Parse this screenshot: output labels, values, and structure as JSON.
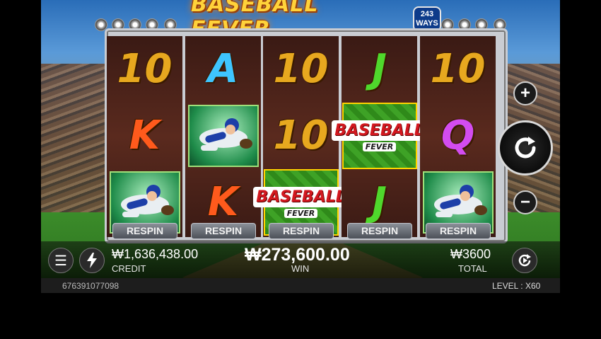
{
  "game": {
    "title": "BASEBALL FEVER",
    "ways_number": "243",
    "ways_label": "WAYS"
  },
  "reels": [
    {
      "symbols": [
        {
          "kind": "text",
          "value": "10"
        },
        {
          "kind": "text",
          "value": "K"
        },
        {
          "kind": "player",
          "value": "player"
        }
      ]
    },
    {
      "symbols": [
        {
          "kind": "text",
          "value": "A"
        },
        {
          "kind": "player",
          "value": "player"
        },
        {
          "kind": "text",
          "value": "K"
        }
      ]
    },
    {
      "symbols": [
        {
          "kind": "text",
          "value": "10"
        },
        {
          "kind": "text",
          "value": "10"
        },
        {
          "kind": "wild",
          "value": "BASEBALL"
        }
      ]
    },
    {
      "symbols": [
        {
          "kind": "text",
          "value": "J"
        },
        {
          "kind": "wild",
          "value": "BASEBALL"
        },
        {
          "kind": "text",
          "value": "J"
        }
      ]
    },
    {
      "symbols": [
        {
          "kind": "text",
          "value": "10"
        },
        {
          "kind": "text",
          "value": "Q"
        },
        {
          "kind": "player",
          "value": "player"
        }
      ]
    }
  ],
  "wild_symbol": {
    "main": "BASEBALL",
    "sub": "FEVER"
  },
  "respin_buttons": [
    "RESPIN",
    "RESPIN",
    "RESPIN",
    "RESPIN",
    "RESPIN"
  ],
  "controls": {
    "plus_icon": "plus-icon",
    "spin_icon": "spin-icon",
    "minus_icon": "minus-icon",
    "menu_icon": "menu-icon",
    "turbo_icon": "lightning-icon",
    "autoplay_icon": "autoplay-icon"
  },
  "status": {
    "credit_value": "₩1,636,438.00",
    "credit_label": "CREDIT",
    "win_value": "₩273,600.00",
    "win_label": "WIN",
    "total_value": "₩3600",
    "total_label": "TOTAL"
  },
  "footer": {
    "session_id": "676391077098",
    "level_label": "LEVEL",
    "level_separator": ":",
    "level_value": "X60"
  }
}
